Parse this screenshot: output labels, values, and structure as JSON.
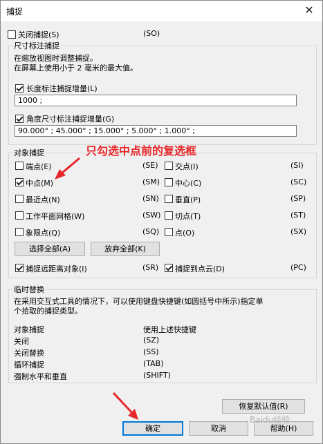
{
  "window": {
    "title": "捕捉",
    "close_glyph": "✕"
  },
  "top": {
    "disable_label": "关闭捕捉(S)",
    "disable_code": "(SO)",
    "disable_checked": false
  },
  "dim": {
    "group_title": "尺寸标注捕捉",
    "desc1": "在缩放视图时调整捕捉。",
    "desc2": "在屏幕上使用小于 2 毫米的最大值。",
    "length_label": "长度标注捕捉增量(L)",
    "length_checked": true,
    "length_value": "1000 ;",
    "angle_label": "角度尺寸标注捕捉增量(G)",
    "angle_checked": true,
    "angle_value": "90.000° ; 45.000° ; 15.000° ; 5.000° ; 1.000° ;"
  },
  "obj": {
    "group_title": "对象捕捉",
    "annotation": "只勾选中点前的复选框",
    "items": [
      {
        "label": "端点(E)",
        "code": "(SE)",
        "checked": false
      },
      {
        "label": "交点(I)",
        "code": "(SI)",
        "checked": false
      },
      {
        "label": "中点(M)",
        "code": "(SM)",
        "checked": true
      },
      {
        "label": "中心(C)",
        "code": "(SC)",
        "checked": false
      },
      {
        "label": "最近点(N)",
        "code": "(SN)",
        "checked": false
      },
      {
        "label": "垂直(P)",
        "code": "(SP)",
        "checked": false
      },
      {
        "label": "工作平面网格(W)",
        "code": "(SW)",
        "checked": false
      },
      {
        "label": "切点(T)",
        "code": "(ST)",
        "checked": false
      },
      {
        "label": "象限点(Q)",
        "code": "(SQ)",
        "checked": false
      },
      {
        "label": "点(O)",
        "code": "(SX)",
        "checked": false
      }
    ],
    "select_all": "选择全部(A)",
    "deselect_all": "放弃全部(K)",
    "remote": {
      "label": "捕捉远距离对象(I)",
      "code": "(SR)",
      "checked": true
    },
    "cloud": {
      "label": "捕捉到点云(D)",
      "code": "(PC)",
      "checked": true
    }
  },
  "temp": {
    "group_title": "临时替换",
    "desc1": "在采用交互式工具的情况下，可以使用键盘快捷键(如圆括号中所示)指定单",
    "desc2": "个拾取的捕捉类型。",
    "rows": [
      {
        "label": "对象捕捉",
        "value": "使用上述快捷键"
      },
      {
        "label": "关闭",
        "value": "(SZ)"
      },
      {
        "label": "关闭替换",
        "value": "(SS)"
      },
      {
        "label": "循环捕捉",
        "value": "(TAB)"
      },
      {
        "label": "强制水平和垂直",
        "value": "(SHIFT)"
      }
    ]
  },
  "buttons": {
    "restore": "恢复默认值(R)",
    "ok": "确定",
    "cancel": "取消",
    "help": "帮助(H)"
  },
  "watermark": "Baidu经验"
}
